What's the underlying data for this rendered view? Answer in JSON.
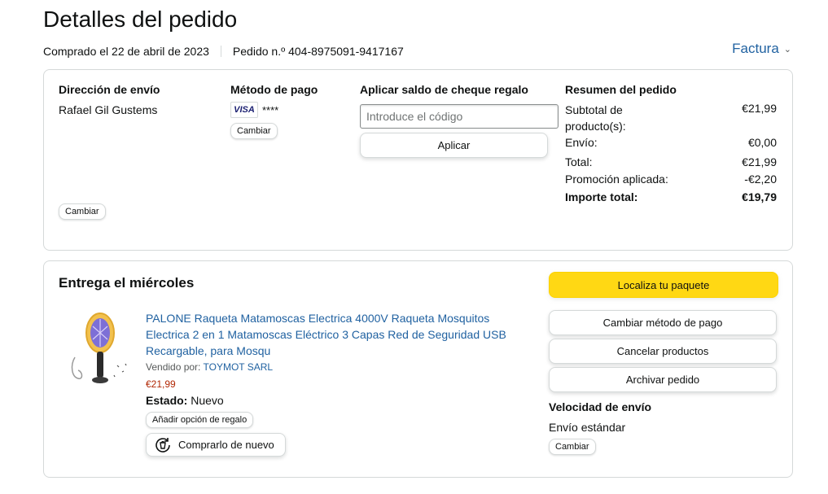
{
  "page": {
    "title": "Detalles del pedido",
    "purchase_date": "Comprado el 22 de abril de 2023",
    "order_number": "Pedido n.º 404-8975091-9417167",
    "invoice_label": "Factura"
  },
  "shipping": {
    "heading": "Dirección de envío",
    "name": "Rafael Gil Gustems",
    "change_label": "Cambiar"
  },
  "payment": {
    "heading": "Método de pago",
    "card_brand": "VISA",
    "card_mask": "****",
    "change_label": "Cambiar"
  },
  "gift": {
    "heading": "Aplicar saldo de cheque regalo",
    "placeholder": "Introduce el código",
    "apply_label": "Aplicar"
  },
  "summary": {
    "heading": "Resumen del pedido",
    "rows": [
      {
        "label": "Subtotal de producto(s):",
        "value": "€21,99"
      },
      {
        "label": "Envío:",
        "value": "€0,00"
      },
      {
        "label": "Total:",
        "value": "€21,99"
      },
      {
        "label": "Promoción aplicada:",
        "value": "-€2,20"
      }
    ],
    "grand_total_label": "Importe total:",
    "grand_total_value": "€19,79"
  },
  "delivery": {
    "heading": "Entrega el miércoles",
    "product": {
      "title": "PALONE Raqueta Matamoscas Electrica 4000V Raqueta Mosquitos Electrica 2 en 1 Matamoscas Eléctrico 3 Capas Red de Seguridad USB Recargable, para Mosqu",
      "sold_by_prefix": "Vendido por:",
      "seller": "TOYMOT SARL",
      "price": "€21,99",
      "condition_label": "Estado:",
      "condition_value": "Nuevo",
      "gift_option_label": "Añadir opción de regalo",
      "buy_again_label": "Comprarlo de nuevo"
    },
    "actions": {
      "track": "Localiza tu paquete",
      "change_payment": "Cambiar método de pago",
      "cancel": "Cancelar productos",
      "archive": "Archivar pedido"
    },
    "speed": {
      "heading": "Velocidad de envío",
      "value": "Envío estándar",
      "change_label": "Cambiar"
    }
  },
  "colors": {
    "link": "#2162a1",
    "price": "#b12704",
    "primary_button": "#ffd814"
  }
}
